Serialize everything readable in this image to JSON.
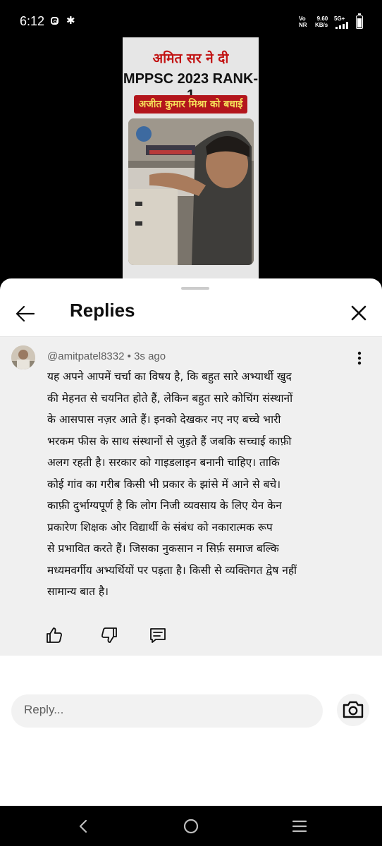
{
  "status_bar": {
    "time": "6:12",
    "network_line1": "Vo",
    "network_line2": "NR",
    "speed_value": "9.60",
    "speed_unit": "KB/s",
    "signal_type": "5G+",
    "icons": [
      "instagram-icon",
      "gear-icon",
      "signal-icon",
      "battery-icon"
    ]
  },
  "video": {
    "headline_line1": "अमित सर ने दी",
    "headline_line2": "MPPSC 2023 RANK-1",
    "banner_text": "अजीत कुमार मिश्रा को बधाई",
    "colors": {
      "headline_red": "#c21313",
      "banner_bg": "#b3151c",
      "banner_text": "#f6e15a"
    }
  },
  "sheet": {
    "title": "Replies",
    "icons": [
      "back-arrow-icon",
      "close-icon"
    ]
  },
  "comment": {
    "author": "@amitpatel8332",
    "separator": "•",
    "time_ago": "3s ago",
    "lines": [
      "यह अपने आपमें चर्चा का विषय है, कि बहुत सारे अभ्यार्थी खुद",
      "की मेहनत से चयनित होते हैं, लेकिन बहुत सारे कोचिंग संस्थानों",
      "के आसपास नज़र आते हैं। इनको देखकर नए नए बच्चे भारी",
      "भरकम फीस के साथ संस्थानों से जुड़ते हैं जबकि सच्चाई काफ़ी",
      "अलग रहती है। सरकार को गाइडलाइन बनानी चाहिए। ताकि",
      "कोई गांव का गरीब किसी भी प्रकार के झांसे में आने से बचे।",
      "काफ़ी दुर्भाग्यपूर्ण है कि लोग निजी व्यवसाय के लिए येन केन",
      "प्रकारेण शिक्षक ओर विद्यार्थी के संबंध को नकारात्मक रूप",
      "से प्रभावित करते हैं। जिसका नुकसान न सिर्फ़ समाज बल्कि",
      "मध्यमवर्गीय अभ्यर्थियों पर पड़ता है। किसी से व्यक्तिगत द्वेष नहीं",
      "सामान्य बात है।"
    ],
    "actions": [
      "thumbs-up-icon",
      "thumbs-down-icon",
      "reply-comment-icon",
      "more-options-icon"
    ]
  },
  "reply_input": {
    "placeholder": "Reply...",
    "camera_icon": "camera-icon"
  },
  "nav_bar": {
    "icons": [
      "back-triangle-icon",
      "home-circle-icon",
      "recents-menu-icon"
    ]
  }
}
